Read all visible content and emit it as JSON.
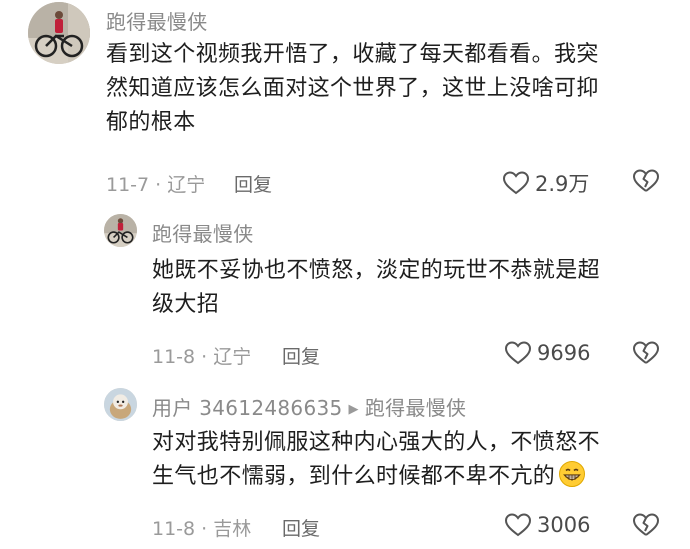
{
  "comments": [
    {
      "username": "跑得最慢侠",
      "text": "看到这个视频我开悟了，收藏了每天都看看。我突然知道应该怎么面对这个世界了，这世上没啥可抑郁的根本",
      "text_lines": [
        "看到这个视频我开悟了，收藏了每天都看看。我突",
        "然知道应该怎么面对这个世界了，这世上没啥可抑",
        "郁的根本"
      ],
      "date_location": "11-7 · 辽宁",
      "reply_label": "回复",
      "likes": "2.9万",
      "avatar_icon": "cyclist-avatar"
    },
    {
      "username": "跑得最慢侠",
      "text": "她既不妥协也不愤怒，淡定的玩世不恭就是超级大招",
      "text_lines": [
        "她既不妥协也不愤怒，淡定的玩世不恭就是超",
        "级大招"
      ],
      "date_location": "11-8 · 辽宁",
      "reply_label": "回复",
      "likes": "9696",
      "avatar_icon": "cyclist-avatar"
    },
    {
      "username": "用户 34612486635",
      "reply_to": "跑得最慢侠",
      "text": "对对我特别佩服这种内心强大的人，不愤怒不生气也不懦弱，到什么时候都不卑不亢的",
      "text_lines": [
        "对对我特别佩服这种内心强大的人，不愤怒不",
        "生气也不懦弱，到什么时候都不卑不亢的"
      ],
      "date_location": "11-8 · 吉林",
      "reply_label": "回复",
      "likes": "3006",
      "avatar_icon": "sheep-avatar",
      "emoji_icon": "grinning-face-emoji"
    }
  ],
  "colors": {
    "username": "#8a8a8a",
    "text": "#1e1e1e",
    "meta": "#9a9a9a",
    "icon": "#555555"
  }
}
